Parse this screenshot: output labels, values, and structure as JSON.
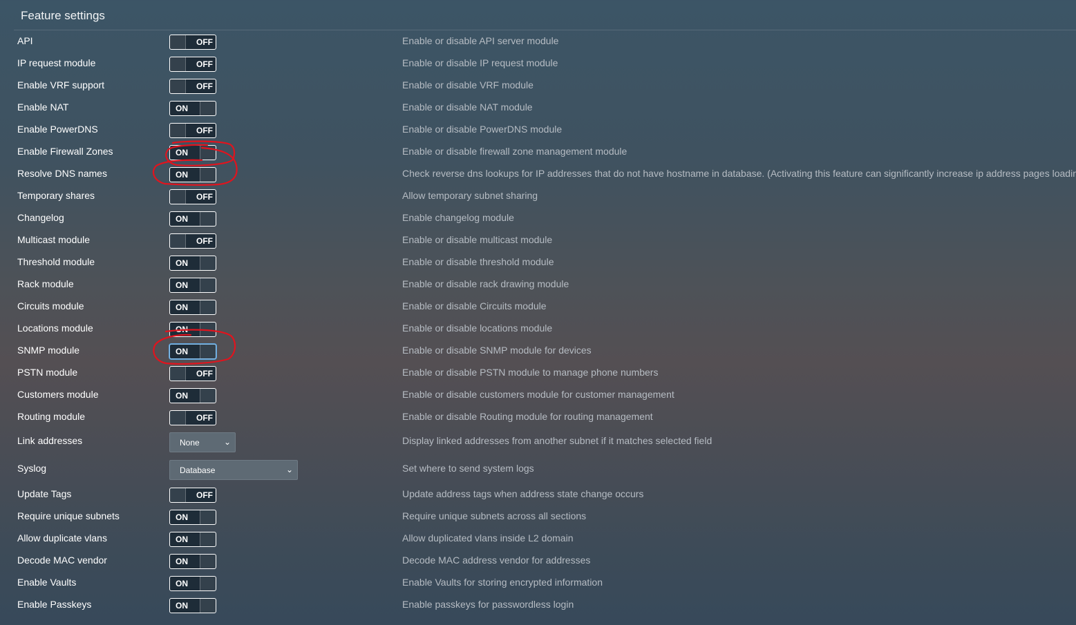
{
  "header": {
    "title": "Feature settings"
  },
  "settings": [
    {
      "label": "API",
      "state": "OFF",
      "description": "Enable or disable API server module"
    },
    {
      "label": "IP request module",
      "state": "OFF",
      "description": "Enable or disable IP request module"
    },
    {
      "label": "Enable VRF support",
      "state": "OFF",
      "description": "Enable or disable VRF module"
    },
    {
      "label": "Enable NAT",
      "state": "ON",
      "description": "Enable or disable NAT module"
    },
    {
      "label": "Enable PowerDNS",
      "state": "OFF",
      "description": "Enable or disable PowerDNS module"
    },
    {
      "label": "Enable Firewall Zones",
      "state": "ON",
      "description": "Enable or disable firewall zone management module"
    },
    {
      "label": "Resolve DNS names",
      "state": "ON",
      "description": "Check reverse dns lookups for IP addresses that do not have hostname in database. (Activating this feature can significantly increase ip address pages loading time!)"
    },
    {
      "label": "Temporary shares",
      "state": "OFF",
      "description": "Allow temporary subnet sharing"
    },
    {
      "label": "Changelog",
      "state": "ON",
      "description": "Enable changelog module"
    },
    {
      "label": "Multicast module",
      "state": "OFF",
      "description": "Enable or disable multicast module"
    },
    {
      "label": "Threshold module",
      "state": "ON",
      "description": "Enable or disable threshold module"
    },
    {
      "label": "Rack module",
      "state": "ON",
      "description": "Enable or disable rack drawing module"
    },
    {
      "label": "Circuits module",
      "state": "ON",
      "description": "Enable or disable Circuits module"
    },
    {
      "label": "Locations module",
      "state": "ON",
      "description": "Enable or disable locations module"
    },
    {
      "label": "SNMP module",
      "state": "ON",
      "description": "Enable or disable SNMP module for devices"
    },
    {
      "label": "PSTN module",
      "state": "OFF",
      "description": "Enable or disable PSTN module to manage phone numbers"
    },
    {
      "label": "Customers module",
      "state": "ON",
      "description": "Enable or disable customers module for customer management"
    },
    {
      "label": "Routing module",
      "state": "OFF",
      "description": "Enable or disable Routing module for routing management"
    },
    {
      "label": "Link addresses",
      "select": "None",
      "description": "Display linked addresses from another subnet if it matches selected field"
    },
    {
      "label": "Syslog",
      "select": "Database",
      "description": "Set where to send system logs"
    },
    {
      "label": "Update Tags",
      "state": "OFF",
      "description": "Update address tags when address state change occurs"
    },
    {
      "label": "Require unique subnets",
      "state": "ON",
      "description": "Require unique subnets across all sections"
    },
    {
      "label": "Allow duplicate vlans",
      "state": "ON",
      "description": "Allow duplicated vlans inside L2 domain"
    },
    {
      "label": "Decode MAC vendor",
      "state": "ON",
      "description": "Decode MAC address vendor for addresses"
    },
    {
      "label": "Enable Vaults",
      "state": "ON",
      "description": "Enable Vaults for storing encrypted information"
    },
    {
      "label": "Enable Passkeys",
      "state": "ON",
      "description": "Enable passkeys for passwordless login"
    }
  ],
  "colors": {
    "annotation": "#e0141e",
    "focus": "#5b9fd6"
  }
}
